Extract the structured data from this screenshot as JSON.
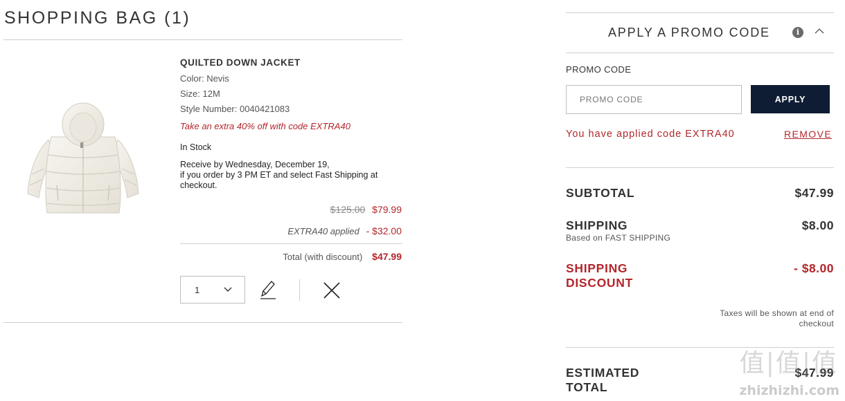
{
  "bag": {
    "title": "SHOPPING BAG (1)"
  },
  "item": {
    "name": "QUILTED DOWN JACKET",
    "color": "Color: Nevis",
    "size": "Size: 12M",
    "style_number": "Style Number: 0040421083",
    "promo_note": "Take an extra 40% off with code EXTRA40",
    "stock": "In Stock",
    "delivery": [
      "Receive by Wednesday, December 19,",
      "if you order by 3 PM ET and select Fast Shipping at",
      "checkout."
    ],
    "original_price": "$125.00",
    "sale_price": "$79.99",
    "discount_label": "EXTRA40 applied",
    "discount_amount": "- $32.00",
    "total_label": "Total (with discount)",
    "total_value": "$47.99",
    "quantity": "1",
    "icons": {
      "edit": "pencil-icon",
      "remove": "close-icon",
      "quantity": "chevron-down-icon"
    }
  },
  "promo": {
    "header": "APPLY A PROMO CODE",
    "info_icon": "i",
    "field_label": "PROMO CODE",
    "placeholder": "PROMO CODE",
    "apply_label": "APPLY",
    "applied_message": "You have applied code EXTRA40",
    "remove_label": "REMOVE"
  },
  "summary": {
    "subtotal_label": "SUBTOTAL",
    "subtotal_value": "$47.99",
    "shipping_label": "SHIPPING",
    "shipping_sub": "Based on FAST SHIPPING",
    "shipping_value": "$8.00",
    "shipping_discount_label_1": "SHIPPING",
    "shipping_discount_label_2": "DISCOUNT",
    "shipping_discount_value": "- $8.00",
    "tax_note_1": "Taxes will be shown at end of",
    "tax_note_2": "checkout",
    "estimated_label_1": "ESTIMATED",
    "estimated_label_2": "TOTAL",
    "estimated_value": "$47.99"
  },
  "watermark": {
    "logo": "值|值|值",
    "text": "zhizhizhi.com"
  },
  "colors": {
    "accent_red": "#b3262b",
    "button_navy": "#0e1d33",
    "rule": "#cfcfcf"
  }
}
